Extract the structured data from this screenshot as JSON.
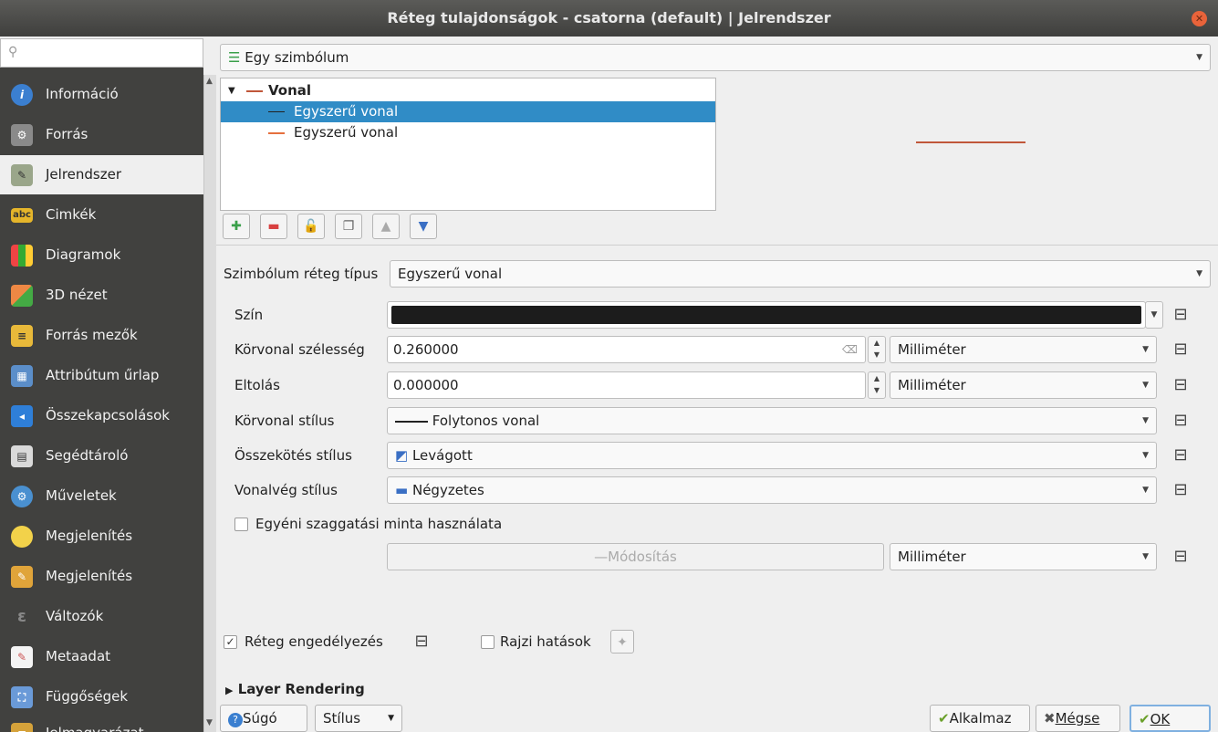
{
  "window": {
    "title": "Réteg tulajdonságok - csatorna (default) | Jelrendszer"
  },
  "sidebar": {
    "search_placeholder": "",
    "items": [
      {
        "label": "Információ",
        "icon": "info-icon"
      },
      {
        "label": "Forrás",
        "icon": "source-icon"
      },
      {
        "label": "Jelrendszer",
        "icon": "symbology-icon"
      },
      {
        "label": "Cimkék",
        "icon": "labels-icon"
      },
      {
        "label": "Diagramok",
        "icon": "diagrams-icon"
      },
      {
        "label": "3D nézet",
        "icon": "3d-view-icon"
      },
      {
        "label": "Forrás mezők",
        "icon": "fields-icon"
      },
      {
        "label": "Attribútum űrlap",
        "icon": "attribute-form-icon"
      },
      {
        "label": "Összekapcsolások",
        "icon": "joins-icon"
      },
      {
        "label": "Segédtároló",
        "icon": "auxiliary-storage-icon"
      },
      {
        "label": "Műveletek",
        "icon": "actions-icon"
      },
      {
        "label": "Megjelenítés",
        "icon": "display-icon"
      },
      {
        "label": "Megjelenítés",
        "icon": "rendering-icon"
      },
      {
        "label": "Változók",
        "icon": "variables-icon"
      },
      {
        "label": "Metaadat",
        "icon": "metadata-icon"
      },
      {
        "label": "Függőségek",
        "icon": "dependencies-icon"
      },
      {
        "label": "Jelmagyarázat",
        "icon": "legend-icon"
      }
    ]
  },
  "renderer": {
    "selected": "Egy szimbólum"
  },
  "symbol_tree": {
    "root": "Vonal",
    "layers": [
      "Egyszerű vonal",
      "Egyszerű vonal"
    ]
  },
  "layer_type": {
    "label": "Szimbólum réteg típus",
    "value": "Egyszerű vonal"
  },
  "props": {
    "color_label": "Szín",
    "color_value": "#1c1c1c",
    "width_label": "Körvonal szélesség",
    "width_value": "0.260000",
    "width_unit": "Milliméter",
    "offset_label": "Eltolás",
    "offset_value": "0.000000",
    "offset_unit": "Milliméter",
    "pen_style_label": "Körvonal stílus",
    "pen_style_value": "Folytonos vonal",
    "join_style_label": "Összekötés stílus",
    "join_style_value": "Levágott",
    "cap_style_label": "Vonalvég stílus",
    "cap_style_value": "Négyzetes",
    "custom_dash_label": "Egyéni szaggatási minta használata",
    "custom_dash_checked": false,
    "modify_label": "Módosítás",
    "modify_unit": "Milliméter"
  },
  "bottom": {
    "enable_layer_label": "Réteg engedélyezés",
    "enable_layer_checked": true,
    "draw_effects_label": "Rajzi hatások",
    "draw_effects_checked": false,
    "layer_rendering_label": "Layer Rendering"
  },
  "buttons": {
    "help": "Súgó",
    "style": "Stílus",
    "apply": "Alkalmaz",
    "cancel": "Mégse",
    "ok": "OK"
  },
  "colors": {
    "accent": "#308cc6",
    "line_preview": "#c0573a",
    "sidebar_bg": "#41413f"
  }
}
